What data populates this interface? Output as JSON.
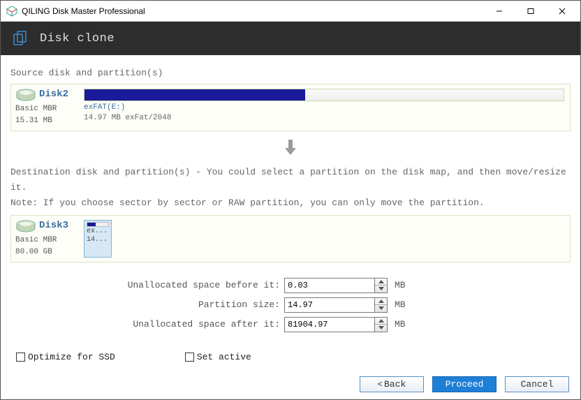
{
  "window": {
    "title": "QILING Disk Master Professional"
  },
  "header": {
    "title": "Disk clone"
  },
  "source": {
    "label": "Source disk and partition(s)",
    "disk": {
      "name": "Disk2",
      "type": "Basic MBR",
      "size": "15.31 MB"
    },
    "partition": {
      "label": "exFAT(E:)",
      "desc": "14.97 MB exFat/2048",
      "fill_pct": 46
    }
  },
  "destination": {
    "label_line1": "Destination disk and partition(s) - You could select a partition on the disk map, and then move/resize it.",
    "label_line2": "Note: If you choose sector by sector or RAW partition, you can only move the partition.",
    "disk": {
      "name": "Disk3",
      "type": "Basic MBR",
      "size": "80.00 GB"
    },
    "partition": {
      "mini1": "ex...",
      "mini2": "14..."
    }
  },
  "fields": {
    "before": {
      "label": "Unallocated space before it:",
      "value": "0.03",
      "unit": "MB"
    },
    "size": {
      "label": "Partition size:",
      "value": "14.97",
      "unit": "MB"
    },
    "after": {
      "label": "Unallocated space after it:",
      "value": "81904.97",
      "unit": "MB"
    }
  },
  "checks": {
    "ssd": "Optimize for SSD",
    "active": "Set active"
  },
  "buttons": {
    "back": "Back",
    "proceed": "Proceed",
    "cancel": "Cancel"
  }
}
